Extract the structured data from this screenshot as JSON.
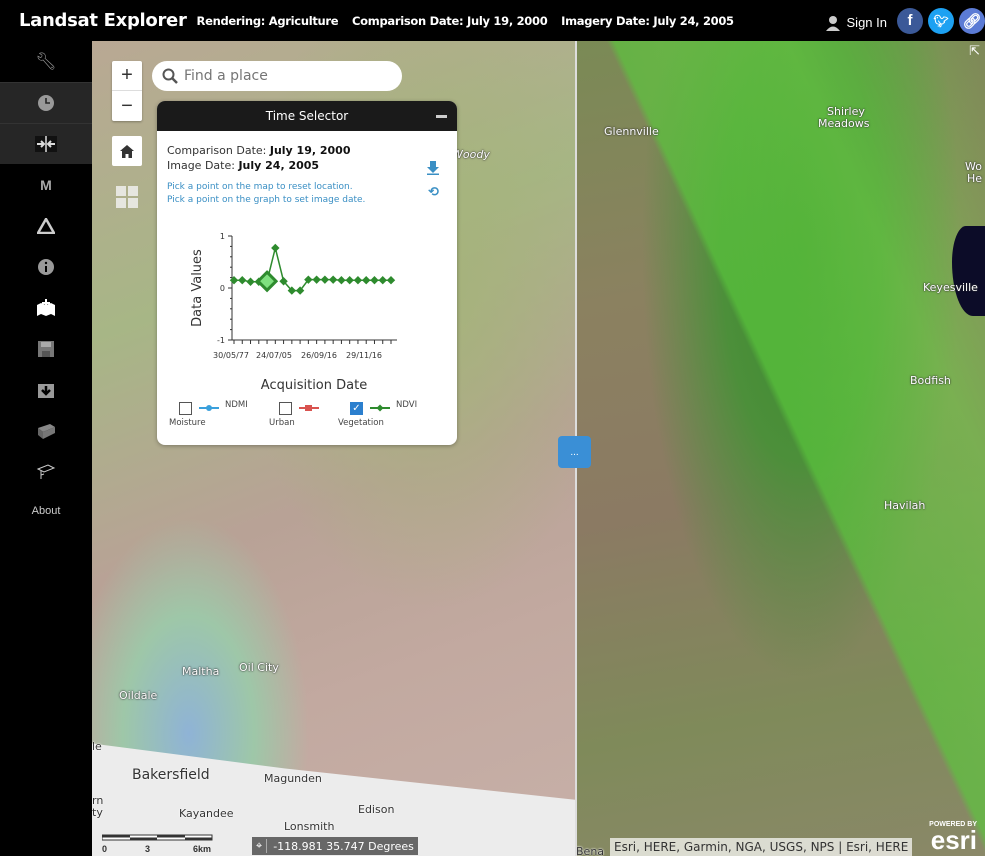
{
  "header": {
    "app_title": "Landsat Explorer",
    "rendering": "Rendering: Agriculture",
    "comparison_date": "Comparison Date: July 19, 2000",
    "imagery_date": "Imagery Date: July 24, 2005",
    "sign_in": "Sign In",
    "social": [
      {
        "name": "facebook",
        "glyph": "f",
        "color": "#3b5998"
      },
      {
        "name": "twitter",
        "glyph": "t",
        "color": "#1da1f2"
      },
      {
        "name": "link",
        "glyph": "∞",
        "color": "#5b7bd5"
      }
    ]
  },
  "sidebar": {
    "items": [
      {
        "name": "wrench",
        "glyph": "🔧",
        "active": false
      },
      {
        "name": "clock",
        "glyph": "◷",
        "active": true
      },
      {
        "name": "swipe",
        "glyph": "⇥⇤",
        "active": true
      },
      {
        "name": "m",
        "glyph": "M",
        "active": false
      },
      {
        "name": "triangle",
        "glyph": "△",
        "active": false
      },
      {
        "name": "info",
        "glyph": "ⓘ",
        "active": false
      },
      {
        "name": "add-bookmark",
        "glyph": "✚",
        "active": false
      },
      {
        "name": "save",
        "glyph": "▣",
        "active": false
      },
      {
        "name": "download",
        "glyph": "⬇",
        "active": false
      },
      {
        "name": "book",
        "glyph": "▰",
        "active": false
      },
      {
        "name": "graduation-cap",
        "glyph": "⌂",
        "active": false
      }
    ],
    "about": "About"
  },
  "map": {
    "search_placeholder": "Find a place",
    "zoom_in": "+",
    "zoom_out": "−",
    "swipe_handle": "...",
    "places": [
      {
        "label": "Woody",
        "side": "left"
      },
      {
        "label": "Glennville",
        "side": "right"
      },
      {
        "label": "Shirley",
        "side": "right"
      },
      {
        "label": "Meadows",
        "side": "right"
      },
      {
        "label": "Wo",
        "side": "right"
      },
      {
        "label": "He",
        "side": "right"
      },
      {
        "label": "Keyesville",
        "side": "right"
      },
      {
        "label": "Bodfish",
        "side": "right"
      },
      {
        "label": "Havilah",
        "side": "right"
      },
      {
        "label": "Maltha",
        "side": "left"
      },
      {
        "label": "Oil City",
        "side": "left"
      },
      {
        "label": "Oildale",
        "side": "left"
      },
      {
        "label": "le",
        "side": "left"
      },
      {
        "label": "Bakersfield",
        "side": "left"
      },
      {
        "label": "Magunden",
        "side": "left"
      },
      {
        "label": "rn",
        "side": "left"
      },
      {
        "label": "ty",
        "side": "left"
      },
      {
        "label": "Kayandee",
        "side": "left"
      },
      {
        "label": "Edison",
        "side": "left"
      },
      {
        "label": "Lonsmith",
        "side": "left"
      },
      {
        "label": "Bena",
        "side": "right"
      }
    ],
    "scale_labels": [
      "0",
      "3",
      "6km"
    ],
    "coordinates": "-118.981 35.747 Degrees",
    "attribution": "Esri, HERE, Garmin, NGA, USGS, NPS | Esri, HERE",
    "esri_powered": "POWERED BY",
    "esri_logo": "esri"
  },
  "time_selector": {
    "title": "Time Selector",
    "comparison_label": "Comparison Date: ",
    "comparison_value": "July 19, 2000",
    "image_label": "Image Date: ",
    "image_value": "July 24, 2005",
    "hint1": "Pick a point on the map to reset location.",
    "hint2": "Pick a point on the graph to set image date.",
    "legend": [
      {
        "code": "NDMI",
        "name": "Moisture",
        "checked": false,
        "color": "#3aa0dc"
      },
      {
        "code": "",
        "name": "Urban",
        "checked": false,
        "color": "#d9534f"
      },
      {
        "code": "NDVI",
        "name": "Vegetation",
        "checked": true,
        "color": "#2e8b2e"
      }
    ]
  },
  "chart_data": {
    "type": "line",
    "title": "",
    "xlabel": "Acquisition Date",
    "ylabel": "Data Values",
    "ylim": [
      -1,
      1
    ],
    "yticks": [
      "1",
      "0",
      "-1"
    ],
    "xtick_labels": [
      "30/05/77",
      "24/07/05",
      "26/09/16",
      "29/11/16"
    ],
    "series": [
      {
        "name": "NDVI",
        "color": "#2e8b2e",
        "values": [
          0.15,
          0.15,
          0.12,
          0.12,
          0.13,
          0.77,
          0.13,
          -0.05,
          -0.05,
          0.16,
          0.16,
          0.16,
          0.16,
          0.15,
          0.15,
          0.15,
          0.15,
          0.15,
          0.15,
          0.15
        ],
        "selected_index": 4
      }
    ]
  }
}
